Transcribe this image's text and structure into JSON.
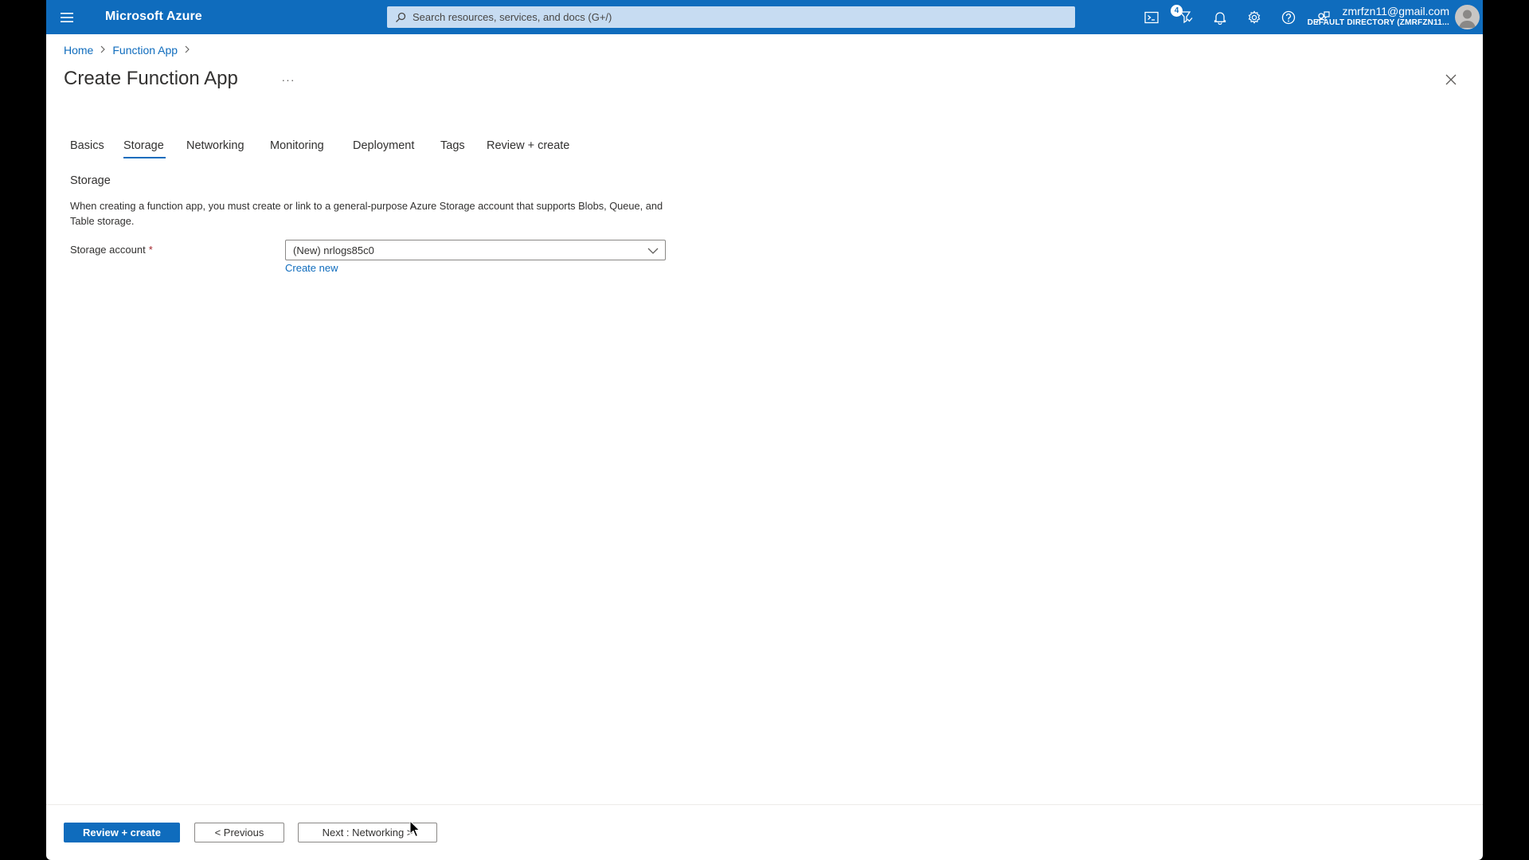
{
  "topbar": {
    "brand": "Microsoft Azure",
    "search_placeholder": "Search resources, services, and docs (G+/)",
    "notification_count": "4",
    "account_email": "zmrfzn11@gmail.com",
    "account_directory": "DEFAULT DIRECTORY (ZMRFZN11...",
    "icons": [
      "menu-icon",
      "cloud-shell-icon",
      "directory-filter-icon",
      "bell-icon",
      "gear-icon",
      "help-icon",
      "feedback-icon"
    ],
    "color": "#0f6cbd"
  },
  "breadcrumb": [
    "Home",
    "Function App"
  ],
  "page": {
    "title": "Create Function App",
    "more_label": "···"
  },
  "tabs": [
    {
      "label": "Basics",
      "active": false
    },
    {
      "label": "Storage",
      "active": true
    },
    {
      "label": "Networking",
      "active": false
    },
    {
      "label": "Monitoring",
      "active": false
    },
    {
      "label": "Deployment",
      "active": false
    },
    {
      "label": "Tags",
      "active": false
    },
    {
      "label": "Review + create",
      "active": false
    }
  ],
  "storage": {
    "section_title": "Storage",
    "description": "When creating a function app, you must create or link to a general-purpose Azure Storage account that supports Blobs, Queue, and Table storage.",
    "account_label": "Storage account",
    "required_mark": "*",
    "selected_value": "(New) nrlogs85c0",
    "create_new_label": "Create new"
  },
  "footer": {
    "review_create_label": "Review + create",
    "previous_label": "< Previous",
    "next_label": "Next : Networking >"
  }
}
